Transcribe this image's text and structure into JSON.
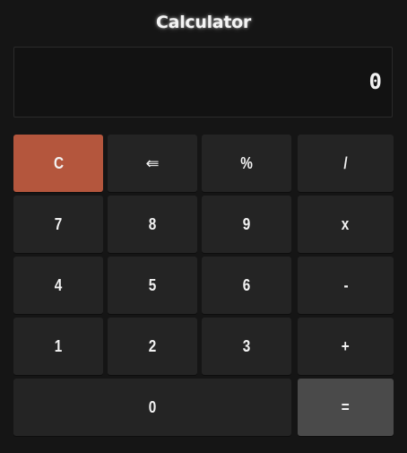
{
  "app": {
    "title": "Calculator"
  },
  "display": {
    "value": "0"
  },
  "keys": {
    "clear": "C",
    "backspace": "⇚",
    "percent": "%",
    "divide": "/",
    "seven": "7",
    "eight": "8",
    "nine": "9",
    "multiply": "x",
    "four": "4",
    "five": "5",
    "six": "6",
    "subtract": "-",
    "one": "1",
    "two": "2",
    "three": "3",
    "add": "+",
    "zero": "0",
    "equals": "="
  },
  "colors": {
    "background": "#151515",
    "key": "#242424",
    "clear_key": "#b4563d",
    "equals_key": "#4a4a4a",
    "text": "#f2f2f2"
  }
}
